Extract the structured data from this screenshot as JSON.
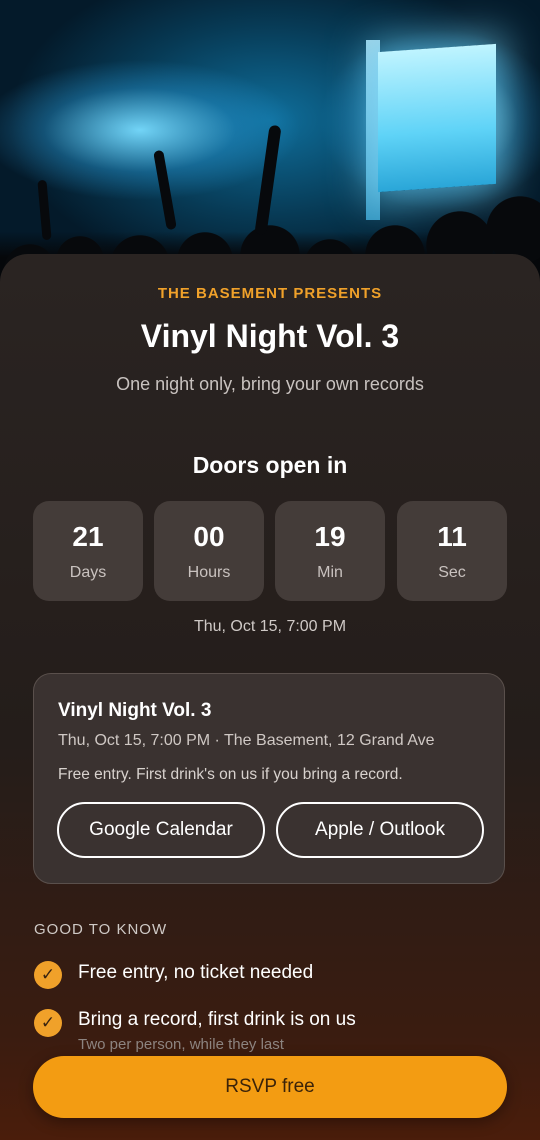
{
  "hero": {
    "alt": "concert crowd"
  },
  "event": {
    "eyebrow": "THE BASEMENT PRESENTS",
    "title": "Vinyl Night Vol. 3",
    "subtitle": "One night only, bring your own records"
  },
  "countdown": {
    "heading": "Doors open in",
    "units": [
      {
        "value": "21",
        "label": "Days"
      },
      {
        "value": "00",
        "label": "Hours"
      },
      {
        "value": "19",
        "label": "Min"
      },
      {
        "value": "11",
        "label": "Sec"
      }
    ],
    "date": "Thu, Oct 15, 7:00 PM"
  },
  "calendar_card": {
    "title": "Vinyl Night Vol. 3",
    "meta": "Thu, Oct 15, 7:00 PM · The Basement, 12 Grand Ave",
    "description": "Free entry. First drink's on us if you bring a record.",
    "google_label": "Google Calendar",
    "apple_label": "Apple / Outlook"
  },
  "good_to_know": {
    "heading": "GOOD TO KNOW",
    "items": [
      {
        "text": "Free entry, no ticket needed",
        "sub": ""
      },
      {
        "text": "Bring a record, first drink is on us",
        "sub": "Two per person, while they last"
      }
    ],
    "check_icon": "✓"
  },
  "rsvp": {
    "label": "RSVP free"
  },
  "colors": {
    "accent": "#f39c12",
    "eyebrow": "#f0a12a",
    "card": "#3a3230"
  }
}
